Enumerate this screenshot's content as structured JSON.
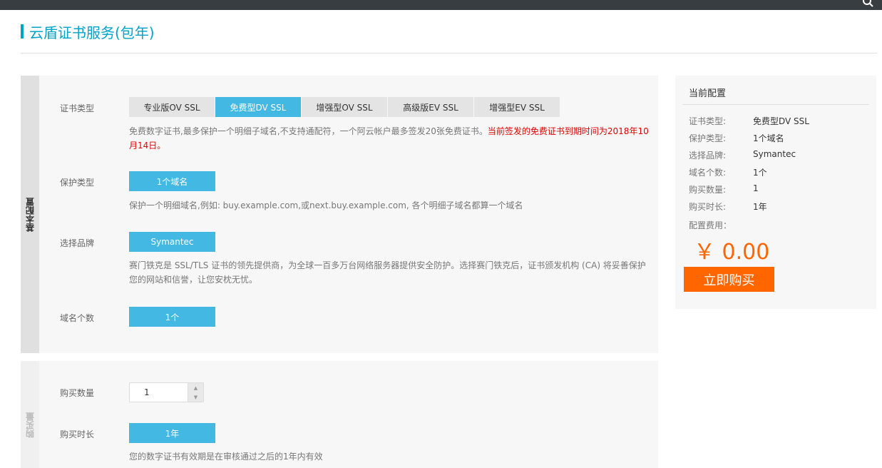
{
  "header": {
    "page_title": "云盾证书服务(包年)"
  },
  "basic_config": {
    "side_label": "基本配置",
    "cert_type": {
      "label": "证书类型",
      "options": [
        "专业版OV SSL",
        "免费型DV SSL",
        "增强型OV SSL",
        "高级版EV SSL",
        "增强型EV SSL"
      ],
      "selected": "免费型DV SSL",
      "description": "免费数字证书,最多保护一个明细子域名,不支持通配符，一个阿云帐户最多签发20张免费证书。",
      "warning": "当前签发的免费证书到期时间为2018年10月14日。"
    },
    "protect_type": {
      "label": "保护类型",
      "value": "1个域名",
      "description": "保护一个明细域名,例如: buy.example.com,或next.buy.example.com, 各个明细子域名都算一个域名"
    },
    "brand": {
      "label": "选择品牌",
      "value": "Symantec",
      "description": "赛门铁克是 SSL/TLS 证书的领先提供商，为全球一百多万台网络服务器提供安全防护。选择赛门铁克后，证书颁发机构 (CA) 将妥善保护您的网站和信誉，让您安枕无忧。"
    },
    "domain_count": {
      "label": "域名个数",
      "value": "1个"
    }
  },
  "purchase": {
    "side_label": "购买量",
    "quantity": {
      "label": "购买数量",
      "value": "1"
    },
    "duration": {
      "label": "购买时长",
      "value": "1年",
      "description": "您的数字证书有效期是在审核通过之后的1年内有效"
    }
  },
  "summary": {
    "title": "当前配置",
    "rows": [
      {
        "label": "证书类型:",
        "value": "免费型DV SSL"
      },
      {
        "label": "保护类型:",
        "value": "1个域名"
      },
      {
        "label": "选择品牌:",
        "value": "Symantec"
      },
      {
        "label": "域名个数:",
        "value": "1个"
      },
      {
        "label": "购买数量:",
        "value": "1"
      },
      {
        "label": "购买时长:",
        "value": "1年"
      }
    ],
    "fee_label": "配置费用：",
    "price": "￥ 0.00",
    "buy_button": "立即购买"
  },
  "icons": {
    "search": "search-icon"
  },
  "colors": {
    "accent": "#00a2ca",
    "selected": "#42b8e3",
    "price": "#ff6600",
    "warning": "#e10000"
  }
}
